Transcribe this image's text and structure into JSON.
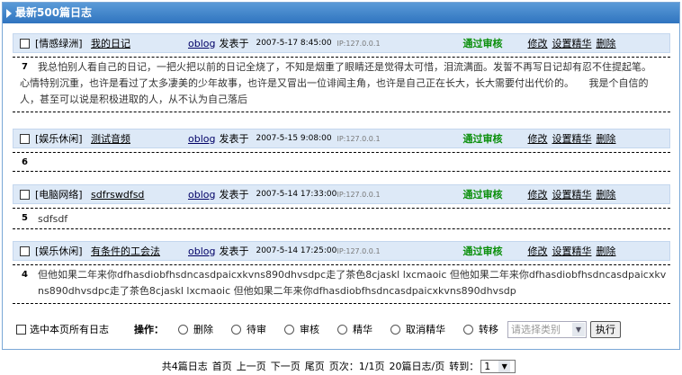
{
  "header": {
    "title": "最新500篇日志"
  },
  "entries": [
    {
      "category": "[情感绿洲]",
      "title": "我的日记",
      "author": "oblog",
      "posted": "发表于",
      "date": "2007-5-17 8:45:00",
      "ip": "IP:127.0.0.1",
      "status": "通过审核",
      "num": "7",
      "content": "我总怕别人看自己的日记，一把火把以前的日记全烧了，不知是烟重了眼睛还是觉得太可惜，泪流满面。发誓不再写日记却有忍不住提起笔。　　心情特别沉重，也许是看过了太多凄美的少年故事，也许是又冒出一位诽闻主角，也许是自己正在长大，长大需要付出代价的。　　我是个自信的人，甚至可以说是积极进取的人，从不认为自己落后"
    },
    {
      "category": "[娱乐休闲]",
      "title": "测试音频",
      "author": "oblog",
      "posted": "发表于",
      "date": "2007-5-15 9:08:00",
      "ip": "IP:127.0.0.1",
      "status": "通过审核",
      "num": "6",
      "content": ""
    },
    {
      "category": "[电脑网络]",
      "title": "sdfrswdfsd",
      "author": "oblog",
      "posted": "发表于",
      "date": "2007-5-14 17:33:00",
      "ip": "IP:127.0.0.1",
      "status": "通过审核",
      "num": "5",
      "content": "sdfsdf"
    },
    {
      "category": "[娱乐休闲]",
      "title": "有条件的工会法",
      "author": "oblog",
      "posted": "发表于",
      "date": "2007-5-14 17:25:00",
      "ip": "IP:127.0.0.1",
      "status": "通过审核",
      "num": "4",
      "content": "但他如果二年来你dfhasdiobfhsdncasdpaicxkvns890dhvsdpc走了茶色8cjaskl lxcmaoic 但他如果二年来你dfhasdiobfhsdncasdpaicxkvns890dhvsdpc走了茶色8cjaskl lxcmaoic 但他如果二年来你dfhasdiobfhsdncasdpaicxkvns890dhvsdp"
    }
  ],
  "actions": {
    "edit": "修改",
    "digest": "设置精华",
    "delete": "删除"
  },
  "ops": {
    "select_all": "选中本页所有日志",
    "label": "操作：",
    "options": [
      "删除",
      "待审",
      "审核",
      "精华",
      "取消精华",
      "转移"
    ],
    "category_placeholder": "请选择类别",
    "submit": "执行"
  },
  "pager": {
    "total": "共4篇日志",
    "first": "首页",
    "prev": "上一页",
    "next": "下一页",
    "last": "尾页",
    "pages": "页次：1/1页",
    "per_page": "20篇日志/页",
    "goto": "转到：",
    "goto_value": "1"
  }
}
